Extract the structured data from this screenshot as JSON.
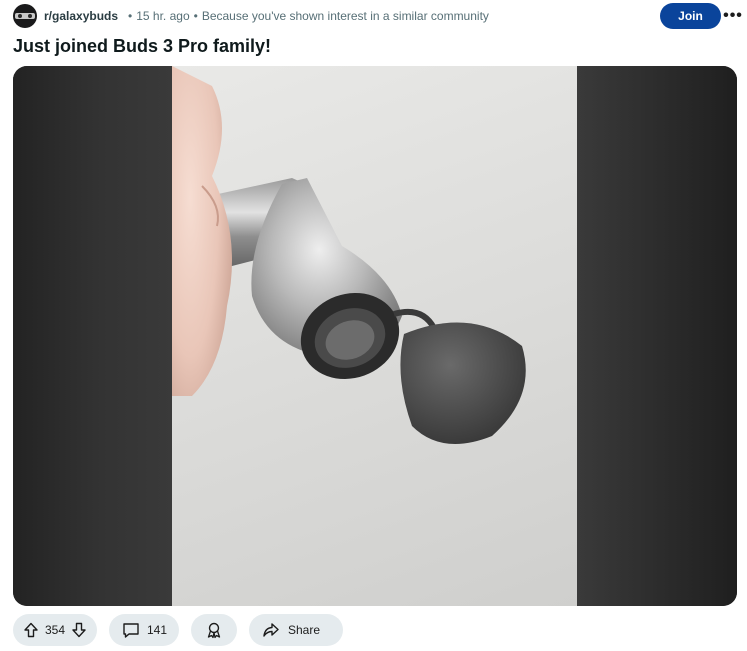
{
  "post": {
    "subreddit": "r/galaxybuds",
    "time_ago": "15 hr. ago",
    "recommendation": "Because you've shown interest in a similar community",
    "join_label": "Join",
    "more_label": "•••",
    "title": "Just joined Buds 3 Pro family!"
  },
  "media": {
    "description_icon": "earbud-photo"
  },
  "actions": {
    "upvotes": "354",
    "comments": "141",
    "share_label": "Share"
  },
  "colors": {
    "join_button": "#0a449b",
    "pill_background": "#e5ebee",
    "media_backdrop": "#2a2a2a"
  }
}
